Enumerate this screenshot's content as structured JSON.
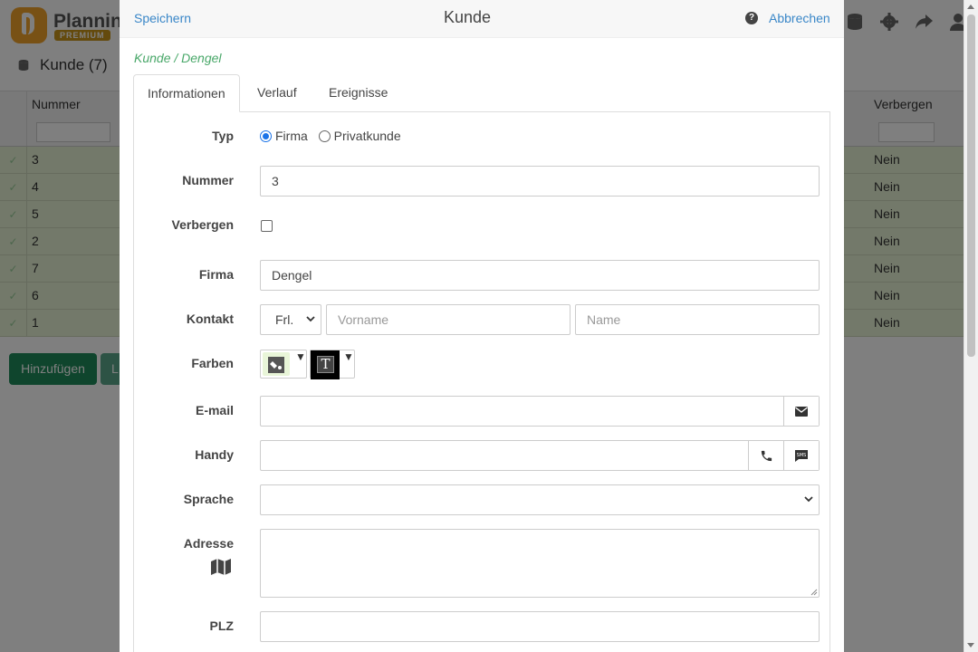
{
  "background": {
    "brand": "Planning",
    "badge": "PREMIUM",
    "section_label": "Kunde (7)",
    "columns": {
      "number": "Nummer",
      "hide": "Verbergen"
    },
    "rows": [
      {
        "number": "3",
        "hide": "Nein"
      },
      {
        "number": "4",
        "hide": "Nein"
      },
      {
        "number": "5",
        "hide": "Nein"
      },
      {
        "number": "2",
        "hide": "Nein"
      },
      {
        "number": "7",
        "hide": "Nein"
      },
      {
        "number": "6",
        "hide": "Nein"
      },
      {
        "number": "1",
        "hide": "Nein"
      }
    ],
    "add_button": "Hinzufügen",
    "second_button_fragment": "L"
  },
  "modal": {
    "save_label": "Speichern",
    "title": "Kunde",
    "cancel_label": "Abbrechen",
    "help_glyph": "?",
    "breadcrumb": "Kunde / Dengel",
    "tabs": [
      {
        "label": "Informationen",
        "active": true
      },
      {
        "label": "Verlauf",
        "active": false
      },
      {
        "label": "Ereignisse",
        "active": false
      }
    ],
    "form": {
      "type": {
        "label": "Typ",
        "options": [
          "Firma",
          "Privatkunde"
        ],
        "selected": "Firma"
      },
      "number": {
        "label": "Nummer",
        "value": "3"
      },
      "hide": {
        "label": "Verbergen",
        "checked": false
      },
      "company": {
        "label": "Firma",
        "value": "Dengel"
      },
      "contact": {
        "label": "Kontakt",
        "salutation": "Frl.",
        "first_name_placeholder": "Vorname",
        "last_name_placeholder": "Name"
      },
      "colors": {
        "label": "Farben",
        "background_color": "#e8f5d8",
        "text_color": "#000000",
        "text_glyph": "T"
      },
      "email": {
        "label": "E-mail",
        "value": "",
        "icon": "envelope-icon"
      },
      "mobile": {
        "label": "Handy",
        "value": "",
        "icons": [
          "phone-icon",
          "sms-icon"
        ]
      },
      "language": {
        "label": "Sprache",
        "value": ""
      },
      "address": {
        "label": "Adresse",
        "value": "",
        "icon": "map-icon"
      },
      "zip": {
        "label": "PLZ",
        "value": ""
      }
    }
  },
  "colors": {
    "link": "#3a87c8",
    "breadcrumb": "#4aa86a",
    "row_highlight": "#e6f2d4",
    "primary_button": "#1f8a5b",
    "radio_accent": "#1a73e8"
  }
}
